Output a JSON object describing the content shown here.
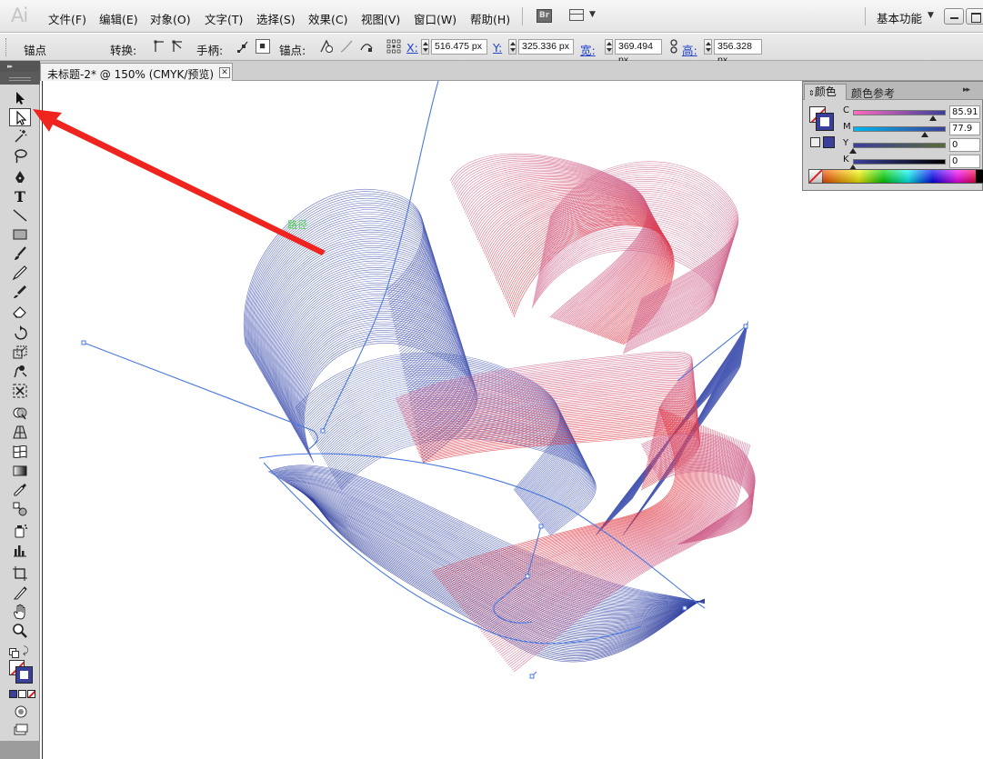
{
  "app": {
    "logo": "Ai",
    "menus": [
      "文件(F)",
      "编辑(E)",
      "对象(O)",
      "文字(T)",
      "选择(S)",
      "效果(C)",
      "视图(V)",
      "窗口(W)",
      "帮助(H)"
    ],
    "bridge_button": "Br",
    "workspace_label": "基本功能"
  },
  "control_bar": {
    "mode_label": "锚点",
    "convert_label": "转换:",
    "handles_label": "手柄:",
    "anchors_label": "锚点:",
    "x_label": "X:",
    "x_value": "516.475 px",
    "y_label": "Y:",
    "y_value": "325.336 px",
    "w_label": "宽:",
    "w_value": "369.494 px",
    "h_label": "高:",
    "h_value": "356.328 px"
  },
  "document": {
    "tab_title": "未标题-2* @ 150% (CMYK/预览)",
    "close_glyph": "✕",
    "path_tooltip": "路径",
    "art_colors": {
      "blue": "#4a5bb4",
      "pink": "#d0668f",
      "red": "#e0303a",
      "path": "#4a78e0"
    }
  },
  "toolbox": {
    "tools": [
      {
        "name": "selection-tool",
        "active": false
      },
      {
        "name": "direct-selection-tool",
        "active": true
      },
      {
        "name": "magic-wand-tool",
        "active": false
      },
      {
        "name": "lasso-tool",
        "active": false
      },
      {
        "name": "pen-tool",
        "active": false
      },
      {
        "name": "type-tool",
        "active": false
      },
      {
        "name": "line-segment-tool",
        "active": false
      },
      {
        "name": "rectangle-tool",
        "active": false
      },
      {
        "name": "paintbrush-tool",
        "active": false
      },
      {
        "name": "pencil-tool",
        "active": false
      },
      {
        "name": "blob-brush-tool",
        "active": false
      },
      {
        "name": "eraser-tool",
        "active": false
      },
      {
        "name": "rotate-tool",
        "active": false
      },
      {
        "name": "scale-tool",
        "active": false
      },
      {
        "name": "warp-tool",
        "active": false
      },
      {
        "name": "free-transform-tool",
        "active": false
      },
      {
        "name": "shape-builder-tool",
        "active": false
      },
      {
        "name": "perspective-grid-tool",
        "active": false
      },
      {
        "name": "mesh-tool",
        "active": false
      },
      {
        "name": "gradient-tool",
        "active": false
      },
      {
        "name": "eyedropper-tool",
        "active": false
      },
      {
        "name": "blend-tool",
        "active": false
      },
      {
        "name": "symbol-sprayer-tool",
        "active": false
      },
      {
        "name": "column-graph-tool",
        "active": false
      },
      {
        "name": "artboard-tool",
        "active": false
      },
      {
        "name": "slice-tool",
        "active": false
      },
      {
        "name": "hand-tool",
        "active": false
      },
      {
        "name": "zoom-tool",
        "active": false
      }
    ]
  },
  "color_panel": {
    "tab_color": "颜色",
    "tab_guide": "颜色参考",
    "menu_glyph": "▸▸",
    "stroke_color": "#3a3f9a",
    "channels": [
      {
        "label": "C",
        "value": "85.91",
        "fraction": 0.8591,
        "gradient": "linear-gradient(to right,#ff6bc0,#3a3f9a)"
      },
      {
        "label": "M",
        "value": "77.9",
        "fraction": 0.779,
        "gradient": "linear-gradient(to right,#00b8ef,#3a3f9a)"
      },
      {
        "label": "Y",
        "value": "0",
        "fraction": 0,
        "gradient": "linear-gradient(to right,#3a3f9a,#5a6a3a)"
      },
      {
        "label": "K",
        "value": "0",
        "fraction": 0,
        "gradient": "linear-gradient(to right,#3a3f9a,#000000)"
      }
    ]
  }
}
